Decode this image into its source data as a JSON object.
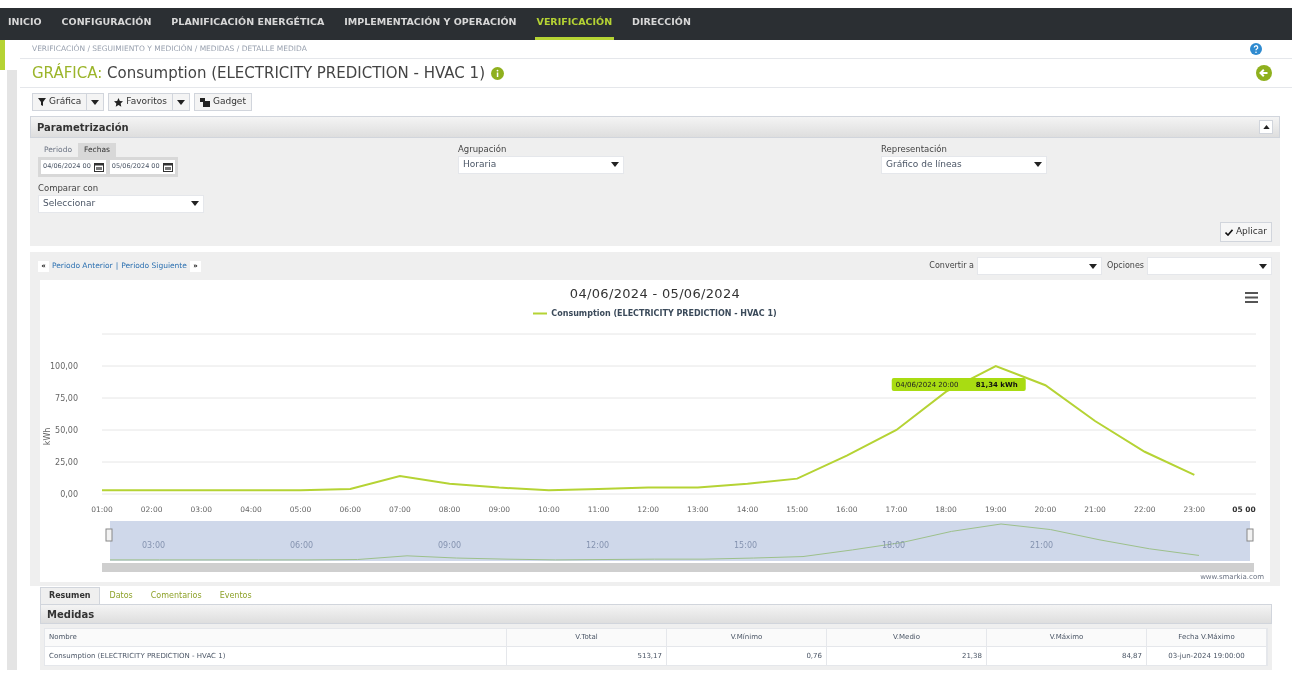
{
  "nav": [
    {
      "label": "INICIO",
      "selected": false
    },
    {
      "label": "CONFIGURACIÓN",
      "selected": false
    },
    {
      "label": "PLANIFICACIÓN ENERGÉTICA",
      "selected": false
    },
    {
      "label": "IMPLEMENTACIÓN Y OPERACIÓN",
      "selected": false
    },
    {
      "label": "VERIFICACIÓN",
      "selected": true
    },
    {
      "label": "DIRECCIÓN",
      "selected": false
    }
  ],
  "breadcrumb": [
    "VERIFICACIÓN",
    "SEGUIMIENTO Y MEDICIÓN",
    "MEDIDAS",
    "DETALLE MEDIDA"
  ],
  "breadcrumb_separator": "/",
  "title": {
    "prefix": "GRÁFICA:",
    "text": "Consumption (ELECTRICITY PREDICTION - HVAC 1)"
  },
  "toolbar": [
    {
      "label": "Gráfica",
      "kind": "filter"
    },
    {
      "label": "Favoritos",
      "kind": "star"
    },
    {
      "label": "Gadget",
      "kind": "gadget"
    }
  ],
  "params": {
    "title": "Parametrización",
    "tabs": [
      {
        "label": "Periodo",
        "selected": false
      },
      {
        "label": "Fechas",
        "selected": true
      }
    ],
    "date_from": "04/06/2024 00",
    "date_to": "05/06/2024 00",
    "compare_label": "Comparar con",
    "compare_value": "Seleccionar",
    "grouping_label": "Agrupación",
    "grouping_value": "Horaria",
    "representation_label": "Representación",
    "representation_value": "Gráfico de líneas",
    "apply": "Aplicar"
  },
  "chart_bar": {
    "prev_icon": "«",
    "next_icon": "»",
    "prev": "Periodo Anterior",
    "separator": "|",
    "next": "Periodo Siguiente",
    "convert_label": "Convertir a",
    "options_label": "Opciones"
  },
  "chart": {
    "chart_data": {
      "type": "line",
      "title": "04/06/2024 - 05/06/2024",
      "ylabel": "kWh",
      "categories": [
        "01:00",
        "02:00",
        "03:00",
        "04:00",
        "05:00",
        "06:00",
        "07:00",
        "08:00",
        "09:00",
        "10:00",
        "11:00",
        "12:00",
        "13:00",
        "14:00",
        "15:00",
        "16:00",
        "17:00",
        "18:00",
        "19:00",
        "20:00",
        "21:00",
        "22:00",
        "23:00"
      ],
      "series": [
        {
          "name": "Consumption (ELECTRICITY PREDICTION - HVAC 1)",
          "color": "#b5d334",
          "values": [
            3,
            3,
            3,
            3,
            3,
            4,
            14,
            8,
            5,
            3,
            4,
            5,
            5,
            8,
            12,
            30,
            50,
            80,
            100,
            85,
            57,
            33,
            15
          ]
        }
      ],
      "ylim": [
        0,
        125
      ],
      "grid": true,
      "yticks": [
        {
          "value": 0,
          "label": "0,00"
        },
        {
          "value": 25,
          "label": "25,00"
        },
        {
          "value": 50,
          "label": "50,00"
        },
        {
          "value": 75,
          "label": "75,00"
        },
        {
          "value": 100,
          "label": "100,00"
        }
      ]
    },
    "x_end_label": "05 00",
    "tooltip": {
      "date": "04/06/2024 20:00",
      "value": "81,34 kWh"
    },
    "navigator_labels": [
      "03:00",
      "06:00",
      "09:00",
      "12:00",
      "15:00",
      "18:00",
      "21:00"
    ],
    "credit": "www.smarkia.com"
  },
  "bottom_tabs": [
    {
      "label": "Resumen",
      "selected": true
    },
    {
      "label": "Datos",
      "selected": false
    },
    {
      "label": "Comentarios",
      "selected": false
    },
    {
      "label": "Eventos",
      "selected": false
    }
  ],
  "measures": {
    "title": "Medidas",
    "columns": [
      "Nombre",
      "V.Total",
      "V.Mínimo",
      "V.Medio",
      "V.Máximo",
      "Fecha V.Máximo"
    ],
    "rows": [
      [
        "Consumption (ELECTRICITY PREDICTION - HVAC 1)",
        "513,17",
        "0,76",
        "21,38",
        "84,87",
        "03-jun-2024 19:00:00"
      ]
    ]
  }
}
